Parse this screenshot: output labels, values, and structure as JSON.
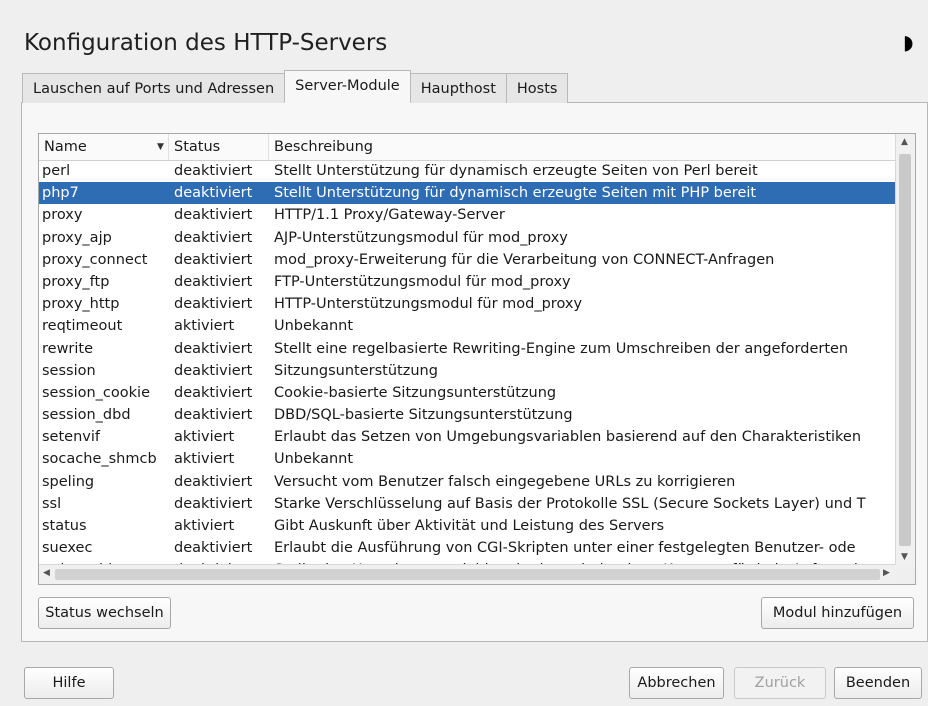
{
  "window": {
    "title": "Konfiguration des HTTP-Servers",
    "corner_glyph": "◗"
  },
  "tabs": [
    {
      "label": "Lauschen auf Ports und Adressen"
    },
    {
      "label": "Server-Module"
    },
    {
      "label": "Haupthost"
    },
    {
      "label": "Hosts"
    }
  ],
  "active_tab": "Server-Module",
  "table": {
    "headers": {
      "name": "Name",
      "status": "Status",
      "description": "Beschreibung"
    },
    "sort_indicator": "▼",
    "selected_row": 1,
    "rows": [
      {
        "name": "perl",
        "status": "deaktiviert",
        "description": "Stellt Unterstützung für dynamisch erzeugte Seiten von Perl bereit"
      },
      {
        "name": "php7",
        "status": "deaktiviert",
        "description": "Stellt Unterstützung für dynamisch erzeugte Seiten mit PHP bereit"
      },
      {
        "name": "proxy",
        "status": "deaktiviert",
        "description": "HTTP/1.1 Proxy/Gateway-Server"
      },
      {
        "name": "proxy_ajp",
        "status": "deaktiviert",
        "description": "AJP-Unterstützungsmodul für mod_proxy"
      },
      {
        "name": "proxy_connect",
        "status": "deaktiviert",
        "description": "mod_proxy-Erweiterung für die Verarbeitung von CONNECT-Anfragen"
      },
      {
        "name": "proxy_ftp",
        "status": "deaktiviert",
        "description": "FTP-Unterstützungsmodul für mod_proxy"
      },
      {
        "name": "proxy_http",
        "status": "deaktiviert",
        "description": "HTTP-Unterstützungsmodul für mod_proxy"
      },
      {
        "name": "reqtimeout",
        "status": "aktiviert",
        "description": "Unbekannt"
      },
      {
        "name": "rewrite",
        "status": "deaktiviert",
        "description": "Stellt eine regelbasierte Rewriting-Engine zum Umschreiben der angeforderten"
      },
      {
        "name": "session",
        "status": "deaktiviert",
        "description": "Sitzungsunterstützung"
      },
      {
        "name": "session_cookie",
        "status": "deaktiviert",
        "description": "Cookie-basierte Sitzungsunterstützung"
      },
      {
        "name": "session_dbd",
        "status": "deaktiviert",
        "description": "DBD/SQL-basierte Sitzungsunterstützung"
      },
      {
        "name": "setenvif",
        "status": "aktiviert",
        "description": "Erlaubt das Setzen von Umgebungsvariablen basierend auf den Charakteristiken"
      },
      {
        "name": "socache_shmcb",
        "status": "aktiviert",
        "description": "Unbekannt"
      },
      {
        "name": "speling",
        "status": "deaktiviert",
        "description": "Versucht vom Benutzer falsch eingegebene URLs zu korrigieren"
      },
      {
        "name": "ssl",
        "status": "deaktiviert",
        "description": "Starke Verschlüsselung auf Basis der Protokolle SSL (Secure Sockets Layer) und T"
      },
      {
        "name": "status",
        "status": "aktiviert",
        "description": "Gibt Auskunft über Aktivität und Leistung des Servers"
      },
      {
        "name": "suexec",
        "status": "deaktiviert",
        "description": "Erlaubt die Ausführung von CGI-Skripten unter einer festgelegten Benutzer- ode"
      },
      {
        "name": "unique_id",
        "status": "deaktiviert",
        "description": "Stellt eine Umgebungsvariable mit einer eindeutigen Kennung für jede Anfrage b"
      }
    ]
  },
  "buttons": {
    "toggle_status": "Status wechseln",
    "add_module": "Modul hinzufügen",
    "help": "Hilfe",
    "cancel": "Abbrechen",
    "back": "Zurück",
    "finish": "Beenden"
  },
  "colors": {
    "selection": "#2e6db4",
    "window_bg": "#efefef"
  }
}
